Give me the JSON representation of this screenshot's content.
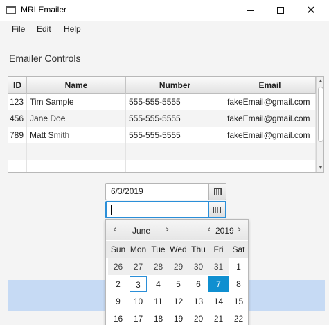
{
  "window": {
    "title": "MRI Emailer"
  },
  "menu": {
    "file": "File",
    "edit": "Edit",
    "help": "Help"
  },
  "section_title": "Emailer Controls",
  "table": {
    "columns": [
      "ID",
      "Name",
      "Number",
      "Email"
    ],
    "rows": [
      [
        "123",
        "Tim Sample",
        "555-555-5555",
        "fakeEmail@gmail.com"
      ],
      [
        "456",
        "Jane Doe",
        "555-555-5555",
        "fakeEmail@gmail.com"
      ],
      [
        "789",
        "Matt Smith",
        "555-555-5555",
        "fakeEmail@gmail.com"
      ]
    ]
  },
  "date_picker_1": {
    "value": "6/3/2019"
  },
  "date_picker_2": {
    "value": ""
  },
  "calendar": {
    "month": "June",
    "year": "2019",
    "weekdays": [
      "Sun",
      "Mon",
      "Tue",
      "Wed",
      "Thu",
      "Fri",
      "Sat"
    ],
    "weeks": [
      [
        "26",
        "27",
        "28",
        "29",
        "30",
        "31",
        "1"
      ],
      [
        "2",
        "3",
        "4",
        "5",
        "6",
        "7",
        "8"
      ],
      [
        "9",
        "10",
        "11",
        "12",
        "13",
        "14",
        "15"
      ],
      [
        "16",
        "17",
        "18",
        "19",
        "20",
        "21",
        "22"
      ]
    ],
    "today": "3",
    "selected": "7",
    "prev_symbol": "‹",
    "next_symbol": "›"
  },
  "colors": {
    "accent": "#0f8fd0",
    "focus": "#2b8fd8",
    "banner": "#c6daf4"
  }
}
